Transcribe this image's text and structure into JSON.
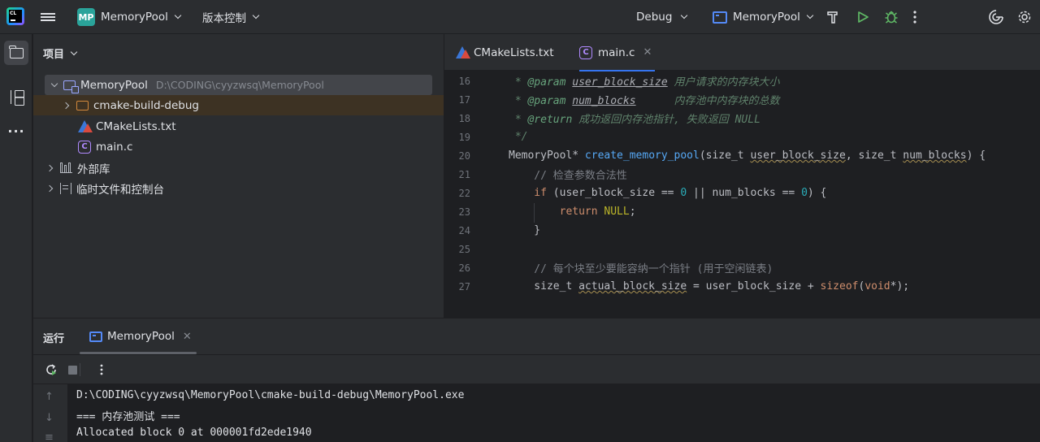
{
  "titlebar": {
    "project_badge": "MP",
    "project_name": "MemoryPool",
    "vcs_label": "版本控制",
    "build_config": "Debug",
    "run_config": "MemoryPool"
  },
  "project_panel": {
    "title": "项目",
    "tree": [
      {
        "label": "MemoryPool",
        "path": "D:\\CODING\\cyyzwsq\\MemoryPool"
      },
      {
        "label": "cmake-build-debug"
      },
      {
        "label": "CMakeLists.txt"
      },
      {
        "label": "main.c"
      },
      {
        "label": "外部库"
      },
      {
        "label": "临时文件和控制台"
      }
    ]
  },
  "editor": {
    "tabs": [
      {
        "label": "CMakeLists.txt"
      },
      {
        "label": "main.c"
      }
    ],
    "line_numbers": [
      "16",
      "17",
      "18",
      "19",
      "20",
      "21",
      "22",
      "23",
      "24",
      "25",
      "26",
      "27"
    ],
    "code": {
      "l16_tag": "@param",
      "l16_param": "user_block_size",
      "l16_desc": "用户请求的内存块大小",
      "l17_tag": "@param",
      "l17_param": "num_blocks",
      "l17_desc": "内存池中内存块的总数",
      "l18_tag": "@return",
      "l18_desc": "成功返回内存池指针, 失败返回 NULL",
      "l19": " */",
      "l20_type": "MemoryPool* ",
      "l20_fn": "create_memory_pool",
      "l20_args1": "(size_t ",
      "l20_p1": "user_block_size",
      "l20_args2": ", size_t ",
      "l20_p2": "num_blocks",
      "l20_args3": ") {",
      "l21": "    // 检查参数合法性",
      "l22_kw": "    if",
      "l22_a": " (user_block_size == ",
      "l22_n1": "0",
      "l22_b": " || num_blocks == ",
      "l22_n2": "0",
      "l22_c": ") {",
      "l23_kw": "        return ",
      "l23_macro": "NULL",
      "l23_end": ";",
      "l24": "    }",
      "l26": "    // 每个块至少要能容纳一个指针 (用于空闲链表)",
      "l27_a": "    size_t ",
      "l27_var": "actual_block_size",
      "l27_b": " = user_block_size + ",
      "l27_kw": "sizeof",
      "l27_c": "(",
      "l27_kw2": "void",
      "l27_d": "*);"
    }
  },
  "run_panel": {
    "title": "运行",
    "tab_label": "MemoryPool",
    "console_lines": [
      "D:\\CODING\\cyyzwsq\\MemoryPool\\cmake-build-debug\\MemoryPool.exe",
      "=== 内存池测试 ===",
      "Allocated block 0 at 000001fd2ede1940"
    ]
  },
  "colors": {
    "accent": "#3574f0",
    "badge": "#2aa39a",
    "run_green": "#5fb865"
  }
}
